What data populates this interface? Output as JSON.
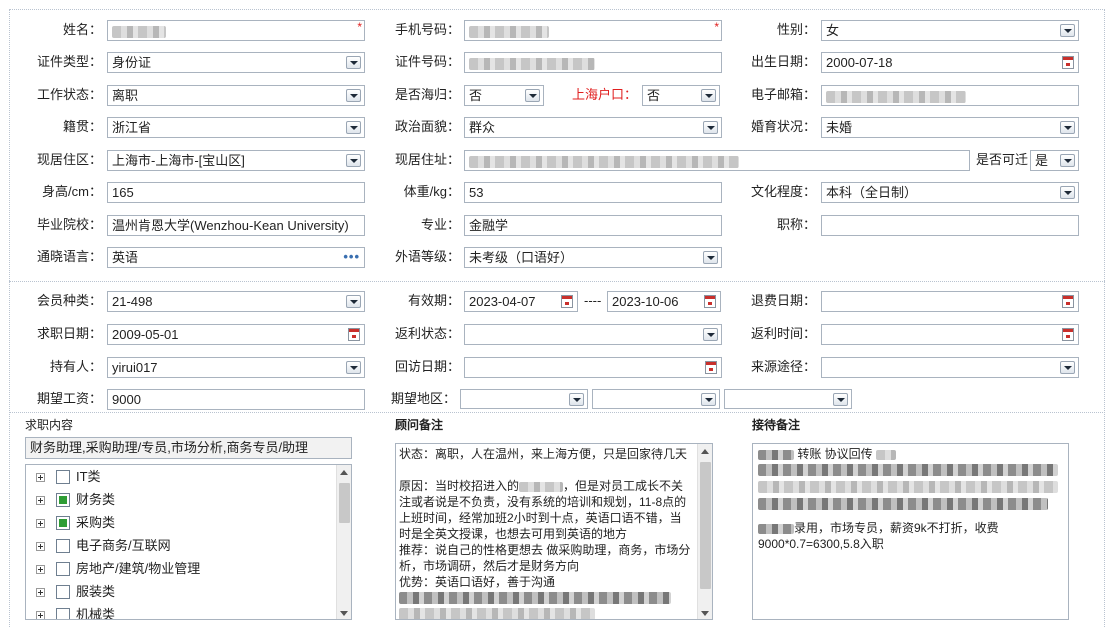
{
  "personal": {
    "name": {
      "label": "姓名：",
      "value": ""
    },
    "phone": {
      "label": "手机号码：",
      "value": ""
    },
    "gender": {
      "label": "性别：",
      "value": "女"
    },
    "id_type": {
      "label": "证件类型：",
      "value": "身份证"
    },
    "id_number": {
      "label": "证件号码：",
      "value": ""
    },
    "birth_date": {
      "label": "出生日期：",
      "value": "2000-07-18"
    },
    "work_status": {
      "label": "工作状态：",
      "value": "离职"
    },
    "returnee": {
      "label": "是否海归：",
      "value": "否"
    },
    "shanghai_hukou": {
      "label": "上海户口：",
      "value": "否"
    },
    "email": {
      "label": "电子邮箱：",
      "value": ""
    },
    "native_place": {
      "label": "籍贯：",
      "value": "浙江省"
    },
    "political": {
      "label": "政治面貌：",
      "value": "群众"
    },
    "marital": {
      "label": "婚育状况：",
      "value": "未婚"
    },
    "residence_area": {
      "label": "现居住区：",
      "value": "上海市-上海市-[宝山区]"
    },
    "address": {
      "label": "现居住址：",
      "value": ""
    },
    "relocate": {
      "label": "是否可迁",
      "value": "是"
    },
    "height": {
      "label": "身高/cm：",
      "value": "165"
    },
    "weight": {
      "label": "体重/kg：",
      "value": "53"
    },
    "education": {
      "label": "文化程度：",
      "value": "本科（全日制）"
    },
    "school": {
      "label": "毕业院校：",
      "value": "温州肯恩大学(Wenzhou-Kean University)"
    },
    "major": {
      "label": "专业：",
      "value": "金融学"
    },
    "title": {
      "label": "职称：",
      "value": ""
    },
    "language": {
      "label": "通晓语言：",
      "value": "英语"
    },
    "language_level": {
      "label": "外语等级：",
      "value": "未考级（口语好）"
    }
  },
  "membership": {
    "type": {
      "label": "会员种类：",
      "value": "21-498"
    },
    "valid": {
      "label": "有效期：",
      "from": "2023-04-07",
      "sep": "----",
      "to": "2023-10-06"
    },
    "refund_date": {
      "label": "退费日期：",
      "value": ""
    },
    "apply_date": {
      "label": "求职日期：",
      "value": "2009-05-01"
    },
    "rebate_status": {
      "label": "返利状态：",
      "value": ""
    },
    "rebate_time": {
      "label": "返利时间：",
      "value": ""
    },
    "holder": {
      "label": "持有人：",
      "value": "yirui017"
    },
    "visit_date": {
      "label": "回访日期：",
      "value": ""
    },
    "source": {
      "label": "来源途径：",
      "value": ""
    },
    "salary": {
      "label": "期望工资：",
      "value": "9000"
    },
    "region": {
      "label": "期望地区：",
      "values": [
        "",
        "",
        ""
      ]
    }
  },
  "job_content": {
    "title": "求职内容",
    "summary": "财务助理,采购助理/专员,市场分析,商务专员/助理",
    "categories": [
      {
        "label": "IT类",
        "checked": false
      },
      {
        "label": "财务类",
        "checked": true
      },
      {
        "label": "采购类",
        "checked": true
      },
      {
        "label": "电子商务/互联网",
        "checked": false
      },
      {
        "label": "房地产/建筑/物业管理",
        "checked": false
      },
      {
        "label": "服装类",
        "checked": false
      },
      {
        "label": "机械类",
        "checked": false
      }
    ]
  },
  "consultant_notes": {
    "title": "顾问备注",
    "lines": [
      "状态：离职，人在温州，来上海方便，只是回家待几天",
      "原因：当时校招进入的",
      "，但是对员工成长不关注或者说是不负责，没有系统的培训和规划，11-8点的上班时间，经常加班2小时到十点，英语口语不错，当时是全英文授课，也想去可用到英语的地方",
      "推荐：说自己的性格更想去 做采购助理，商务，市场分析，市场调研，然后才是财务方向",
      "优势：英语口语好，善于沟通"
    ]
  },
  "reception_notes": {
    "title": "接待备注",
    "line1": "转账 协议回传",
    "line2": "录用，市场专员，薪资9k不打折，收费",
    "line3": "9000*0.7=6300,5.8入职"
  }
}
